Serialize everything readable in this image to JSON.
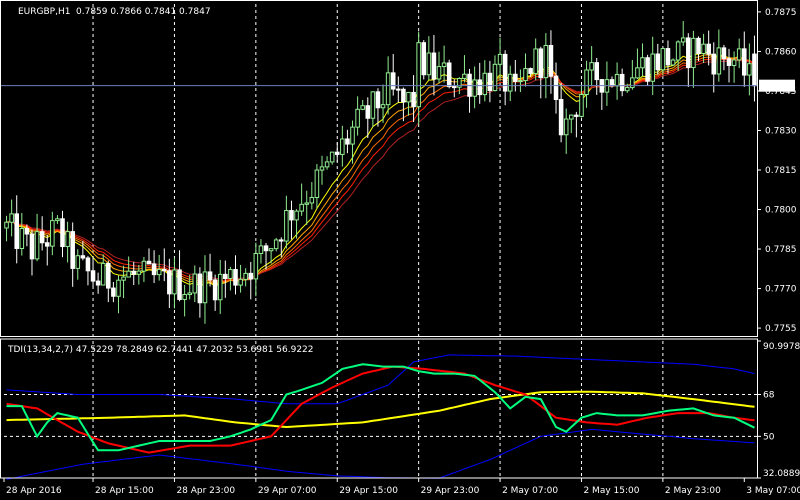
{
  "header": {
    "symbol_label": "EURGBP,H1",
    "ohlc_label": "0.7859 0.7866 0.7841 0.7847"
  },
  "indicator": {
    "label": "TDI(13,34,2,7) 47.5229 78.2849 62.7441 47.2032 53.6981 56.9222"
  },
  "colors": {
    "background": "#000000",
    "bull_candle": "#90ee90",
    "bear_candle": "#ffffff",
    "price_line": "#6a7fbf",
    "grid": "#ffffff",
    "axis": "#ffffff",
    "rsi_line": "#00ff7f",
    "signal_line": "#ff0000",
    "market_base": "#ffff00",
    "bands": "#0000ff",
    "ema_ribbon": [
      "#ffff00",
      "#ffa500",
      "#ff6a00",
      "#ff2000",
      "#b22222"
    ]
  },
  "chart_data": [
    {
      "type": "candlestick",
      "symbol": "EURGBP",
      "timeframe": "H1",
      "ohlc_last": {
        "open": 0.7859,
        "high": 0.7866,
        "low": 0.7841,
        "close": 0.7847
      },
      "current_price_label": "0.7847",
      "current_price": 0.7847,
      "ylim": [
        0.7752,
        0.7878
      ],
      "yticks": [
        "0.7875",
        "0.7860",
        "0.7845",
        "0.7830",
        "0.7815",
        "0.7800",
        "0.7785",
        "0.7770",
        "0.7755"
      ],
      "ytick_values": [
        0.7875,
        0.786,
        0.7845,
        0.783,
        0.7815,
        0.78,
        0.7785,
        0.777,
        0.7755
      ],
      "xticks": [
        "28 Apr 2016",
        "28 Apr 15:00",
        "28 Apr 23:00",
        "29 Apr 07:00",
        "29 Apr 15:00",
        "29 Apr 23:00",
        "2 May 07:00",
        "2 May 15:00",
        "2 May 23:00",
        "3 May 07:00"
      ],
      "grid_bars": [
        17,
        33,
        49,
        65,
        81,
        97,
        113,
        129
      ],
      "n_bars": 148,
      "keypoints": [
        [
          0,
          0.7793
        ],
        [
          5,
          0.7785
        ],
        [
          10,
          0.7792
        ],
        [
          14,
          0.7778
        ],
        [
          18,
          0.7773
        ],
        [
          24,
          0.7775
        ],
        [
          30,
          0.7773
        ],
        [
          36,
          0.7771
        ],
        [
          40,
          0.7772
        ],
        [
          46,
          0.7776
        ],
        [
          50,
          0.7782
        ],
        [
          53,
          0.779
        ],
        [
          56,
          0.78
        ],
        [
          60,
          0.7808
        ],
        [
          64,
          0.7818
        ],
        [
          68,
          0.783
        ],
        [
          72,
          0.7838
        ],
        [
          75,
          0.7845
        ],
        [
          78,
          0.784
        ],
        [
          80,
          0.7842
        ],
        [
          81,
          0.7857
        ],
        [
          84,
          0.7852
        ],
        [
          88,
          0.785
        ],
        [
          93,
          0.7849
        ],
        [
          97,
          0.7852
        ],
        [
          100,
          0.7842
        ],
        [
          103,
          0.7855
        ],
        [
          106,
          0.7858
        ],
        [
          108,
          0.7835
        ],
        [
          110,
          0.7832
        ],
        [
          113,
          0.7845
        ],
        [
          116,
          0.7851
        ],
        [
          120,
          0.785
        ],
        [
          124,
          0.7854
        ],
        [
          128,
          0.7857
        ],
        [
          132,
          0.7858
        ],
        [
          136,
          0.7862
        ],
        [
          139,
          0.7858
        ],
        [
          143,
          0.7857
        ],
        [
          147,
          0.7847
        ]
      ]
    },
    {
      "type": "line",
      "title": "TDI(13,34,2,7)",
      "values": [
        47.5229,
        78.2849,
        62.7441,
        47.2032,
        53.6981,
        56.9222
      ],
      "ylim": [
        32.0889,
        90.9978
      ],
      "yticks": [
        "90.9978",
        "68",
        "50",
        "32.0889"
      ],
      "levels": [
        68,
        50
      ],
      "series": [
        {
          "key": "upper_band",
          "points": [
            [
              0,
              70
            ],
            [
              14,
              68
            ],
            [
              30,
              68
            ],
            [
              45,
              66
            ],
            [
              55,
              64
            ],
            [
              65,
              64
            ],
            [
              75,
              72
            ],
            [
              80,
              82
            ],
            [
              87,
              85
            ],
            [
              100,
              84.5
            ],
            [
              115,
              83
            ],
            [
              125,
              82
            ],
            [
              135,
              81
            ],
            [
              143,
              79
            ],
            [
              147,
              77
            ]
          ]
        },
        {
          "key": "lower_band",
          "points": [
            [
              0,
              31.5
            ],
            [
              15,
              38
            ],
            [
              30,
              42
            ],
            [
              45,
              38
            ],
            [
              55,
              35
            ],
            [
              65,
              33
            ],
            [
              75,
              32.2
            ],
            [
              85,
              32
            ],
            [
              95,
              40
            ],
            [
              105,
              50
            ],
            [
              115,
              53
            ],
            [
              125,
              51
            ],
            [
              135,
              49
            ],
            [
              147,
              47.2
            ]
          ]
        },
        {
          "key": "market_base",
          "points": [
            [
              0,
              57
            ],
            [
              20,
              58
            ],
            [
              35,
              59
            ],
            [
              45,
              56
            ],
            [
              55,
              54
            ],
            [
              70,
              56
            ],
            [
              85,
              61
            ],
            [
              95,
              66
            ],
            [
              105,
              69
            ],
            [
              115,
              69.2
            ],
            [
              125,
              68.5
            ],
            [
              135,
              66
            ],
            [
              147,
              62.7
            ]
          ]
        },
        {
          "key": "signal",
          "points": [
            [
              0,
              64
            ],
            [
              6,
              62
            ],
            [
              14,
              52
            ],
            [
              20,
              47
            ],
            [
              28,
              43
            ],
            [
              36,
              46
            ],
            [
              44,
              46
            ],
            [
              52,
              50
            ],
            [
              58,
              64
            ],
            [
              64,
              71
            ],
            [
              70,
              77
            ],
            [
              76,
              80
            ],
            [
              82,
              79
            ],
            [
              90,
              77
            ],
            [
              96,
              72
            ],
            [
              102,
              68
            ],
            [
              108,
              58
            ],
            [
              114,
              56
            ],
            [
              120,
              55
            ],
            [
              126,
              58
            ],
            [
              132,
              60
            ],
            [
              138,
              60
            ],
            [
              143,
              58
            ],
            [
              147,
              56.9
            ]
          ]
        },
        {
          "key": "rsi_price",
          "points": [
            [
              0,
              63
            ],
            [
              3,
              63
            ],
            [
              6,
              50
            ],
            [
              8,
              56
            ],
            [
              10,
              60
            ],
            [
              14,
              58
            ],
            [
              18,
              44
            ],
            [
              22,
              44
            ],
            [
              26,
              46
            ],
            [
              30,
              48
            ],
            [
              36,
              48
            ],
            [
              40,
              48
            ],
            [
              44,
              50
            ],
            [
              48,
              53
            ],
            [
              52,
              57
            ],
            [
              55,
              68
            ],
            [
              58,
              70
            ],
            [
              62,
              73
            ],
            [
              66,
              79
            ],
            [
              70,
              81
            ],
            [
              74,
              80
            ],
            [
              78,
              80
            ],
            [
              81,
              78
            ],
            [
              84,
              77
            ],
            [
              88,
              77
            ],
            [
              92,
              76
            ],
            [
              96,
              69
            ],
            [
              99,
              62
            ],
            [
              102,
              67
            ],
            [
              105,
              66
            ],
            [
              108,
              54
            ],
            [
              110,
              52
            ],
            [
              113,
              58
            ],
            [
              116,
              60
            ],
            [
              120,
              59
            ],
            [
              125,
              59
            ],
            [
              130,
              61
            ],
            [
              135,
              62
            ],
            [
              139,
              59
            ],
            [
              143,
              58
            ],
            [
              147,
              53.7
            ]
          ]
        }
      ]
    }
  ]
}
